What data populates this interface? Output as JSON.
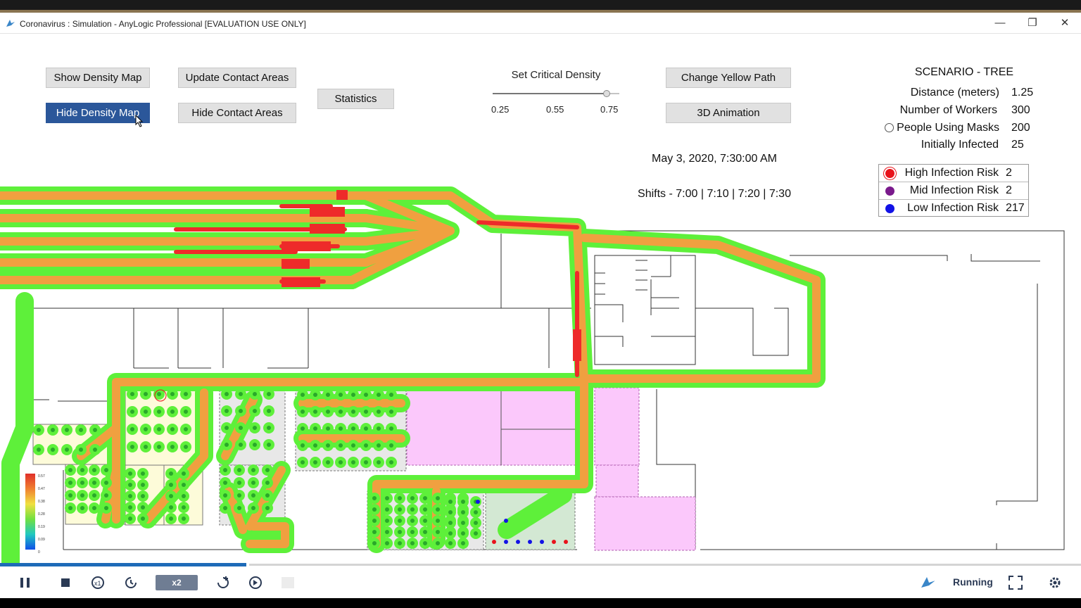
{
  "window": {
    "title": "Coronavirus : Simulation - AnyLogic Professional [EVALUATION USE ONLY]",
    "minimize": "—",
    "restore": "❐",
    "close": "✕"
  },
  "controls": {
    "show_density_map": "Show Density Map",
    "hide_density_map": "Hide Density Map",
    "update_contact_areas": "Update Contact Areas",
    "hide_contact_areas": "Hide Contact Areas",
    "statistics": "Statistics",
    "change_yellow_path": "Change Yellow Path",
    "animation_3d": "3D Animation"
  },
  "slider": {
    "title": "Set Critical Density",
    "min_label": "0.25",
    "mid_label": "0.55",
    "max_label": "0.75",
    "value": 0.7,
    "min": 0.25,
    "max": 0.75
  },
  "datetime": "May 3, 2020, 7:30:00 AM",
  "shifts": "Shifts - 7:00 | 7:10 | 7:20 | 7:30",
  "scenario": {
    "title": "SCENARIO - TREE",
    "params": [
      {
        "label": "Distance (meters)",
        "value": "1.25"
      },
      {
        "label": "Number of Workers",
        "value": "300"
      },
      {
        "label": "People Using Masks",
        "value": "200"
      },
      {
        "label": "Initially Infected",
        "value": "25"
      }
    ]
  },
  "risk": [
    {
      "label": "High Infection Risk",
      "value": "2",
      "color": "#e8121a"
    },
    {
      "label": "Mid Infection Risk",
      "value": "2",
      "color": "#7a1a8c"
    },
    {
      "label": "Low Infection Risk",
      "value": "217",
      "color": "#1212e6"
    }
  ],
  "density_legend": [
    "0.57",
    "0.47",
    "0.38",
    "0.28",
    "0.19",
    "0.09",
    "0"
  ],
  "colors": {
    "path_green": "#5ef03a",
    "path_orange": "#f0a040",
    "hot_red": "#ee2a2a",
    "pink_zone": "#fbc8fb",
    "accent_blue": "#2b579a"
  },
  "toolbar": {
    "speed": "x2",
    "status": "Running",
    "progress": 0.228
  }
}
